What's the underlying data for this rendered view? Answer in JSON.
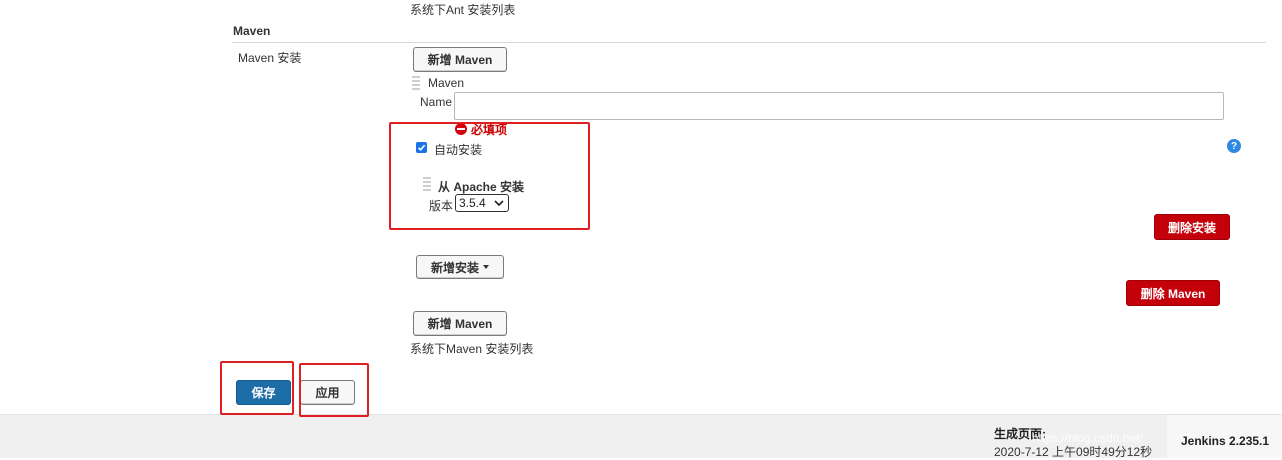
{
  "ant_list_label": "系统下Ant 安装列表",
  "maven_section": {
    "title": "Maven",
    "installs_label": "Maven 安装",
    "add_maven_top": "新增 Maven",
    "item_header": "Maven",
    "name_label": "Name",
    "name_value": "",
    "required_message": "必填项",
    "auto_install_label": "自动安装",
    "auto_install_checked": true,
    "installer_title": "从 Apache 安装",
    "version_label": "版本",
    "version_value": "3.5.4",
    "delete_installer": "删除安装",
    "add_installer": "新增安装",
    "delete_maven": "删除 Maven",
    "add_maven_bottom": "新增 Maven",
    "maven_list_label": "系统下Maven 安装列表"
  },
  "actions": {
    "save": "保存",
    "apply": "应用"
  },
  "footer": {
    "generated_label": "生成页面:",
    "generated_time": "2020-7-12 上午09时49分12秒",
    "version": "Jenkins 2.235.1",
    "watermark": "https://blog.csdn.net/"
  },
  "colors": {
    "accent_blue": "#1d6da8",
    "danger_red": "#c4000a",
    "annotation_red": "#e02020",
    "help_blue": "#2d8ae0"
  },
  "icons": {
    "help": "help-circle-icon",
    "error": "error-circle-icon",
    "dropdown": "caret-down-icon"
  }
}
